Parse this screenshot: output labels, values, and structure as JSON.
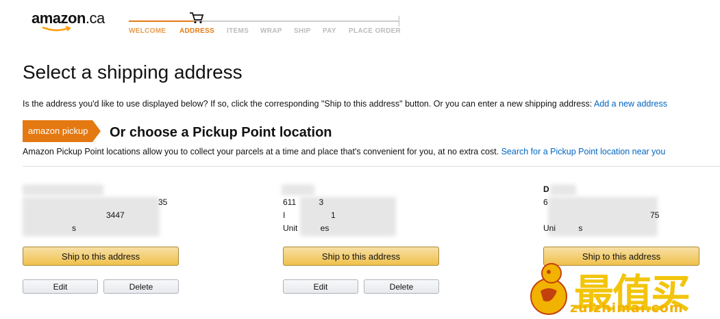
{
  "header": {
    "logo_main": "amazon",
    "logo_suffix": ".ca",
    "steps": [
      "WELCOME",
      "ADDRESS",
      "ITEMS",
      "WRAP",
      "SHIP",
      "PAY",
      "PLACE ORDER"
    ],
    "active_step": "ADDRESS"
  },
  "page": {
    "title": "Select a shipping address",
    "intro_text": "Is the address you'd like to use displayed below? If so, click the corresponding \"Ship to this address\" button. Or you can enter a new shipping address: ",
    "add_address_link": "Add a new address"
  },
  "pickup": {
    "badge_text": "amazon pickup",
    "title": "Or choose a Pickup Point location",
    "description": "Amazon Pickup Point locations allow you to collect your parcels at a time and place that's convenient for you, at no extra cost. ",
    "search_link": "Search for a Pickup Point location near you"
  },
  "addresses": [
    {
      "name": "",
      "line1": "35",
      "line2": "3447",
      "line3": "s",
      "ship_label": "Ship to this address",
      "edit_label": "Edit",
      "delete_label": "Delete"
    },
    {
      "name": "",
      "line1": "611          3",
      "line2": "I                    1",
      "line3": "Unit          es",
      "ship_label": "Ship to this address",
      "edit_label": "Edit",
      "delete_label": "Delete"
    },
    {
      "name": "D",
      "line1": "6",
      "line2": "75",
      "line3": "Uni          s",
      "ship_label": "Ship to this address",
      "edit_label": "Edit",
      "delete_label": "Delete"
    }
  ],
  "watermark": {
    "chars": "最值买",
    "url": "zuizhimai.com"
  },
  "colors": {
    "accent": "#e47911",
    "link": "#0066c0",
    "ship_button": "#f0c14b",
    "watermark": "#f2c200"
  }
}
